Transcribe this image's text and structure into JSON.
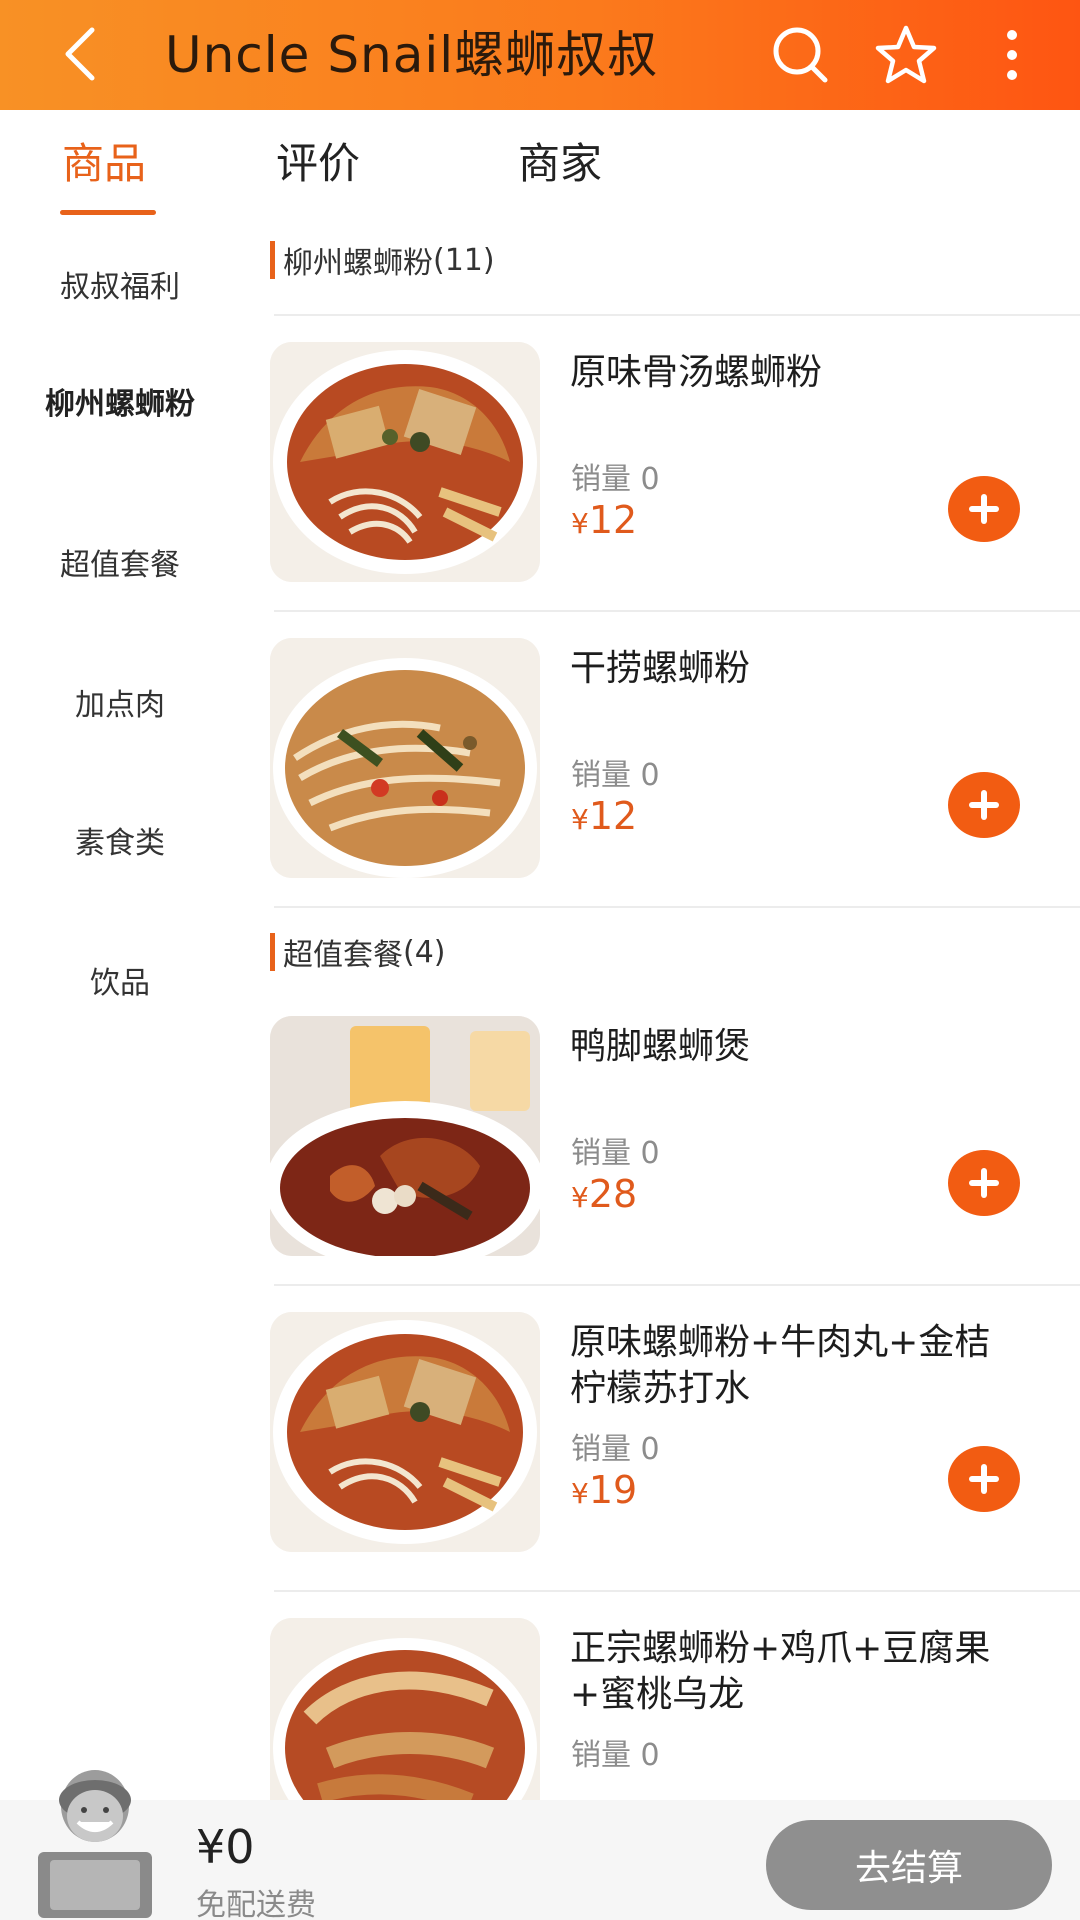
{
  "header": {
    "title": "Uncle Snail螺蛳叔叔",
    "back_icon": "back-chevron-icon",
    "search_icon": "search-icon",
    "favorite_icon": "star-icon",
    "more_icon": "more-vertical-icon"
  },
  "tabs": [
    {
      "label": "商品",
      "active": true
    },
    {
      "label": "评价",
      "active": false
    },
    {
      "label": "商家",
      "active": false
    }
  ],
  "sidebar": {
    "items": [
      {
        "label": "叔叔福利",
        "active": false
      },
      {
        "label": "柳州螺蛳粉",
        "active": true
      },
      {
        "label": "超值套餐",
        "active": false
      },
      {
        "label": "加点肉",
        "active": false
      },
      {
        "label": "素食类",
        "active": false
      },
      {
        "label": "饮品",
        "active": false
      }
    ]
  },
  "sections": [
    {
      "title": "柳州螺蛳粉",
      "count": "(11)",
      "items": [
        {
          "name": "原味骨汤螺蛳粉",
          "sales_label": "销量 0",
          "currency": "¥",
          "price": "12"
        },
        {
          "name": "干捞螺蛳粉",
          "sales_label": "销量 0",
          "currency": "¥",
          "price": "12"
        }
      ]
    },
    {
      "title": "超值套餐",
      "count": "(4)",
      "items": [
        {
          "name": "鸭脚螺蛳煲",
          "sales_label": "销量 0",
          "currency": "¥",
          "price": "28"
        },
        {
          "name": "原味螺蛳粉+牛肉丸+金桔柠檬苏打水",
          "sales_label": "销量 0",
          "currency": "¥",
          "price": "19"
        },
        {
          "name": "正宗螺蛳粉+鸡爪+豆腐果+蜜桃乌龙",
          "sales_label": "销量 0",
          "currency": "¥",
          "price": ""
        }
      ]
    }
  ],
  "bottom_bar": {
    "cart_total": "¥0",
    "delivery_fee": "免配送费",
    "checkout_label": "去结算"
  },
  "colors": {
    "header_start": "#f89125",
    "header_end": "#fe5512",
    "accent": "#e8621a",
    "add_button": "#f25c12",
    "checkout_disabled": "#8f8f8f"
  }
}
